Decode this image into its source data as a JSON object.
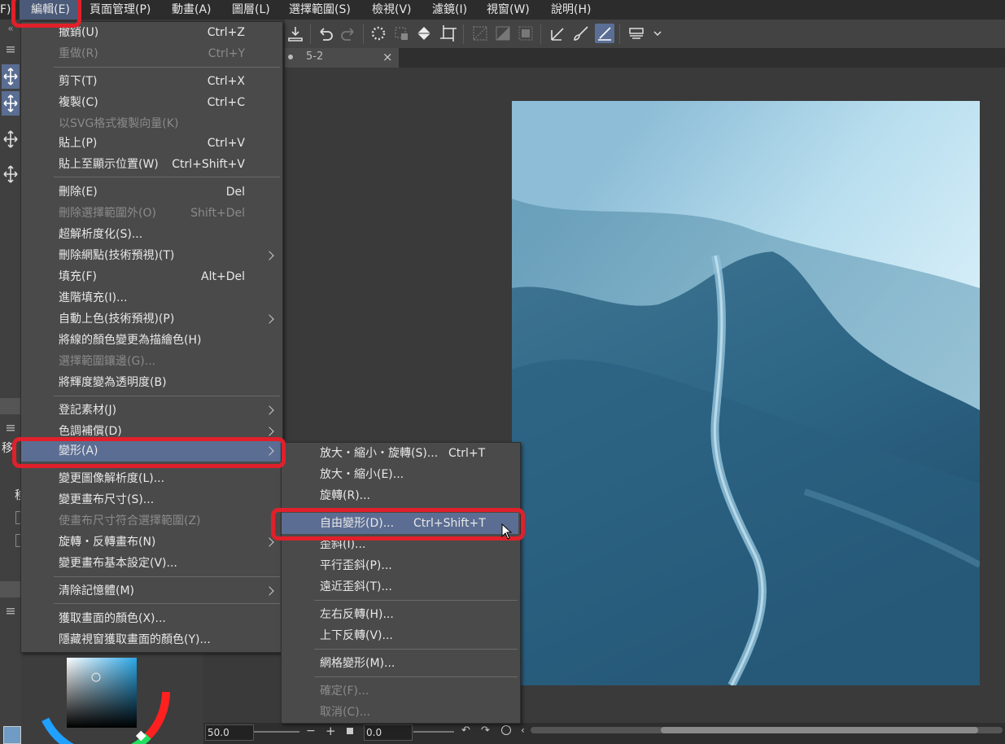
{
  "menubar": {
    "items": [
      "F)",
      "編輯(E)",
      "頁面管理(P)",
      "動畫(A)",
      "圖層(L)",
      "選擇範圍(S)",
      "檢視(V)",
      "濾鏡(I)",
      "視窗(W)",
      "說明(H)"
    ]
  },
  "tab": {
    "title": "5-2",
    "close": "×"
  },
  "left_panel": {
    "labels": [
      "移",
      "移"
    ]
  },
  "status": {
    "zoom": "50.0",
    "angle": "0.0",
    "minus": "−",
    "plus": "+"
  },
  "edit_menu": {
    "items": [
      {
        "label": "撤銷(U)",
        "shortcut": "Ctrl+Z",
        "disabled": false
      },
      {
        "label": "重做(R)",
        "shortcut": "Ctrl+Y",
        "disabled": true
      },
      {
        "label": "剪下(T)",
        "shortcut": "Ctrl+X",
        "disabled": false
      },
      {
        "label": "複製(C)",
        "shortcut": "Ctrl+C",
        "disabled": false
      },
      {
        "label": "以SVG格式複製向量(K)",
        "shortcut": "",
        "disabled": true
      },
      {
        "label": "貼上(P)",
        "shortcut": "Ctrl+V",
        "disabled": false
      },
      {
        "label": "貼上至顯示位置(W)",
        "shortcut": "Ctrl+Shift+V",
        "disabled": false
      },
      {
        "label": "刪除(E)",
        "shortcut": "Del",
        "disabled": false
      },
      {
        "label": "刪除選擇範圍外(O)",
        "shortcut": "Shift+Del",
        "disabled": true
      },
      {
        "label": "超解析度化(S)...",
        "shortcut": "",
        "disabled": false
      },
      {
        "label": "刪除網點(技術預視)(T)",
        "shortcut": "",
        "disabled": false
      },
      {
        "label": "填充(F)",
        "shortcut": "Alt+Del",
        "disabled": false
      },
      {
        "label": "進階填充(I)...",
        "shortcut": "",
        "disabled": false
      },
      {
        "label": "自動上色(技術預視)(P)",
        "shortcut": "",
        "disabled": false
      },
      {
        "label": "將線的顏色變更為描繪色(H)",
        "shortcut": "",
        "disabled": false
      },
      {
        "label": "選擇範圍鑲邊(G)...",
        "shortcut": "",
        "disabled": true
      },
      {
        "label": "將輝度變為透明度(B)",
        "shortcut": "",
        "disabled": false
      },
      {
        "label": "登記素材(J)",
        "shortcut": "",
        "disabled": false
      },
      {
        "label": "色調補償(D)",
        "shortcut": "",
        "disabled": false
      },
      {
        "label": "變形(A)",
        "shortcut": "",
        "disabled": false
      },
      {
        "label": "變更圖像解析度(L)...",
        "shortcut": "",
        "disabled": false
      },
      {
        "label": "變更畫布尺寸(S)...",
        "shortcut": "",
        "disabled": false
      },
      {
        "label": "使畫布尺寸符合選擇範圍(Z)",
        "shortcut": "",
        "disabled": true
      },
      {
        "label": "旋轉・反轉畫布(N)",
        "shortcut": "",
        "disabled": false
      },
      {
        "label": "變更畫布基本設定(V)...",
        "shortcut": "",
        "disabled": false
      },
      {
        "label": "清除記憶體(M)",
        "shortcut": "",
        "disabled": false
      },
      {
        "label": "獲取畫面的顏色(X)...",
        "shortcut": "",
        "disabled": false
      },
      {
        "label": "隱藏視窗獲取畫面的顏色(Y)...",
        "shortcut": "",
        "disabled": false
      }
    ]
  },
  "transform_menu": {
    "items": [
      {
        "label": "放大・縮小・旋轉(S)...",
        "shortcut": "Ctrl+T",
        "disabled": false
      },
      {
        "label": "放大・縮小(E)...",
        "shortcut": "",
        "disabled": false
      },
      {
        "label": "旋轉(R)...",
        "shortcut": "",
        "disabled": false
      },
      {
        "label": "自由變形(D)...",
        "shortcut": "Ctrl+Shift+T",
        "disabled": false
      },
      {
        "label": "歪斜(I)...",
        "shortcut": "",
        "disabled": false
      },
      {
        "label": "平行歪斜(P)...",
        "shortcut": "",
        "disabled": false
      },
      {
        "label": "遠近歪斜(T)...",
        "shortcut": "",
        "disabled": false
      },
      {
        "label": "左右反轉(H)...",
        "shortcut": "",
        "disabled": false
      },
      {
        "label": "上下反轉(V)...",
        "shortcut": "",
        "disabled": false
      },
      {
        "label": "網格變形(M)...",
        "shortcut": "",
        "disabled": false
      },
      {
        "label": "確定(F)...",
        "shortcut": "",
        "disabled": true
      },
      {
        "label": "取消(C)...",
        "shortcut": "",
        "disabled": true
      }
    ]
  },
  "colors": {
    "highlight": "#5b6d92",
    "annotation_red": "#e0202b"
  }
}
